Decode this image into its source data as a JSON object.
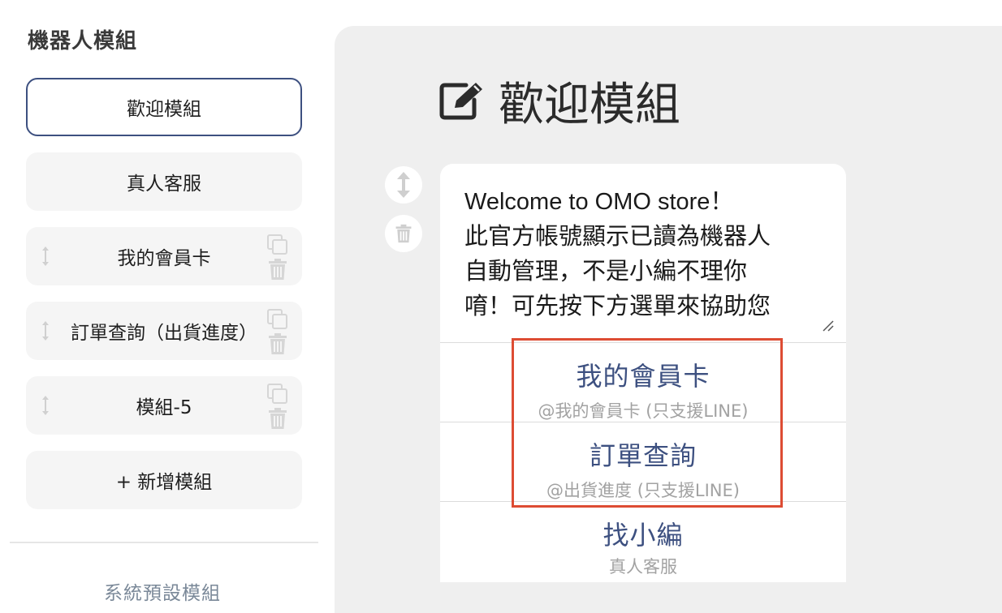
{
  "sidebar": {
    "title": "機器人模組",
    "modules": [
      {
        "label": "歡迎模組",
        "active": true
      },
      {
        "label": "真人客服"
      },
      {
        "label": "我的會員卡"
      },
      {
        "label": "訂單查詢（出貨進度）"
      },
      {
        "label": "模組-5"
      }
    ],
    "add_module": "+ 新增模組",
    "system_default": "系統預設模組"
  },
  "main": {
    "title": "歡迎模組",
    "title_icon": "edit-icon",
    "message": "Welcome to OMO store！\n此官方帳號顯示已讀為機器人\n自動管理，不是小編不理你\n唷！可先按下方選單來協助您",
    "options": [
      {
        "label": "我的會員卡",
        "sub": "@我的會員卡 (只支援LINE)"
      },
      {
        "label": "訂單查詢",
        "sub": "@出貨進度 (只支援LINE)"
      },
      {
        "label": "找小編",
        "sub": "真人客服"
      }
    ]
  },
  "colors": {
    "accent": "#3d5080",
    "highlight": "#dd4c33",
    "panel_bg": "#efefef"
  }
}
